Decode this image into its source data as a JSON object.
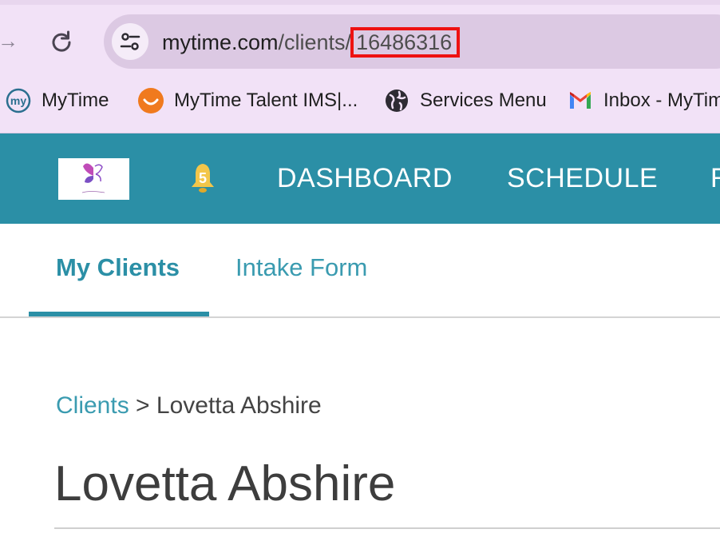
{
  "browser": {
    "url_domain": "mytime.com",
    "url_path": "/clients/",
    "url_id": "16486316",
    "bookmarks": [
      {
        "label": "MyTime",
        "icon": "mytime-logo-icon"
      },
      {
        "label": "MyTime Talent IMS|...",
        "icon": "talent-ims-icon"
      },
      {
        "label": "Services Menu",
        "icon": "globe-icon"
      },
      {
        "label": "Inbox - MyTim",
        "icon": "gmail-icon"
      }
    ],
    "colors": {
      "chrome": "#f2e2f7",
      "addressbar": "#dcc9e3",
      "highlight_box": "#ee1111"
    }
  },
  "header": {
    "notification_count": "5",
    "nav": [
      "DASHBOARD",
      "SCHEDULE",
      "R"
    ],
    "colors": {
      "background": "#2b8fa6",
      "bell": "#f3c64a"
    }
  },
  "tabs": [
    {
      "label": "My Clients",
      "active": true
    },
    {
      "label": "Intake Form",
      "active": false
    }
  ],
  "breadcrumb": {
    "link": "Clients",
    "separator": ">",
    "current": "Lovetta Abshire"
  },
  "page": {
    "title": "Lovetta Abshire"
  }
}
